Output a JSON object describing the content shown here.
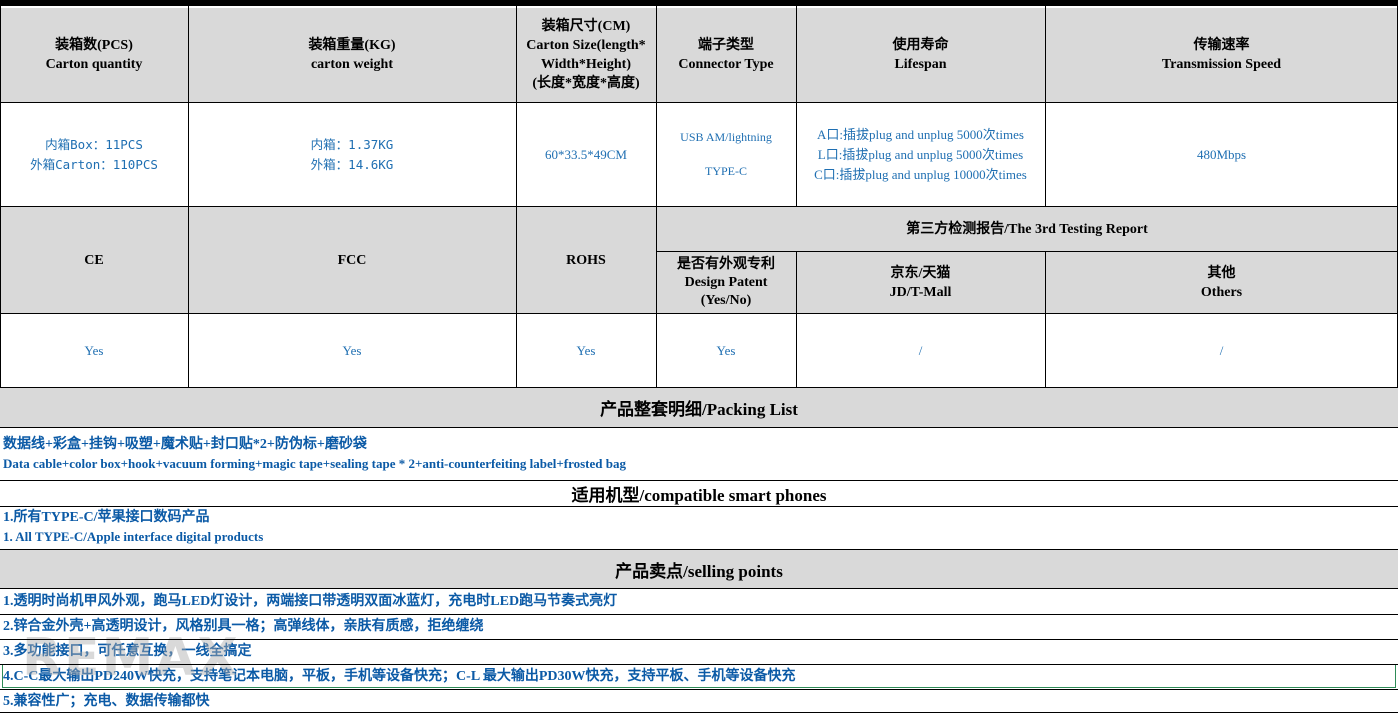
{
  "header_row1": {
    "carton_quantity": {
      "cn": "装箱数(PCS)",
      "en": "Carton quantity"
    },
    "carton_weight": {
      "cn": "装箱重量(KG)",
      "en": "carton weight"
    },
    "carton_size": {
      "cn": "装箱尺寸(CM)",
      "en1": "Carton Size(length*",
      "en2": "Width*Height)",
      "cn2": "(长度*宽度*高度)"
    },
    "connector": {
      "cn": "端子类型",
      "en": "Connector Type"
    },
    "lifespan": {
      "cn": "使用寿命",
      "en": "Lifespan"
    },
    "speed": {
      "cn": "传输速率",
      "en": "Transmission Speed"
    }
  },
  "values_row1": {
    "qty_inner": "内箱Box：11PCS",
    "qty_outer": "外箱Carton：110PCS",
    "weight_inner": "内箱：1.37KG",
    "weight_outer": "外箱：14.6KG",
    "size": "60*33.5*49CM",
    "connector1": "USB AM/lightning",
    "connector2": "TYPE-C",
    "life_a": "A口:插拔plug and unplug 5000次times",
    "life_l": "L口:插拔plug and unplug 5000次times",
    "life_c": "C口:插拔plug and unplug 10000次times",
    "speed": "480Mbps"
  },
  "header_row2": {
    "ce": "CE",
    "fcc": "FCC",
    "rohs": "ROHS",
    "third_party": "第三方检测报告/The 3rd Testing Report",
    "patent_cn": "是否有外观专利",
    "patent_en1": "Design Patent",
    "patent_en2": "(Yes/No)",
    "jd_cn": "京东/天猫",
    "jd_en": "JD/T-Mall",
    "others_cn": "其他",
    "others_en": "Others"
  },
  "values_row2": {
    "ce": "Yes",
    "fcc": "Yes",
    "rohs": "Yes",
    "patent": "Yes",
    "jd": "/",
    "others": "/"
  },
  "packing": {
    "title": "产品整套明细/Packing List",
    "cn": "数据线+彩盒+挂钩+吸塑+魔术贴+封口贴*2+防伪标+磨砂袋",
    "en": "Data cable+color box+hook+vacuum forming+magic tape+sealing tape * 2+anti-counterfeiting label+frosted bag"
  },
  "compatible": {
    "title": "适用机型/compatible smart phones",
    "cn": "1.所有TYPE-C/苹果接口数码产品",
    "en": "1. All TYPE-C/Apple interface digital products"
  },
  "selling": {
    "title": "产品卖点/selling points",
    "points": [
      "1.透明时尚机甲风外观，跑马LED灯设计，两端接口带透明双面冰蓝灯，充电时LED跑马节奏式亮灯",
      "2.锌合金外壳+高透明设计，风格别具一格；高弹线体，亲肤有质感，拒绝缠绕",
      "3.多功能接口，可任意互换，一线全搞定",
      "4.C-C最大输出PD240W快充，支持笔记本电脑，平板，手机等设备快充；C-L 最大输出PD30W快充，支持平板、手机等设备快充",
      "5.兼容性广；充电、数据传输都快"
    ]
  },
  "watermark": "REMAX",
  "colors": {
    "header_gray": "#d9d9d9",
    "value_blue": "#1f6fb2",
    "text_blue": "#0b5aa6",
    "highlight_green": "#2e8b57"
  }
}
